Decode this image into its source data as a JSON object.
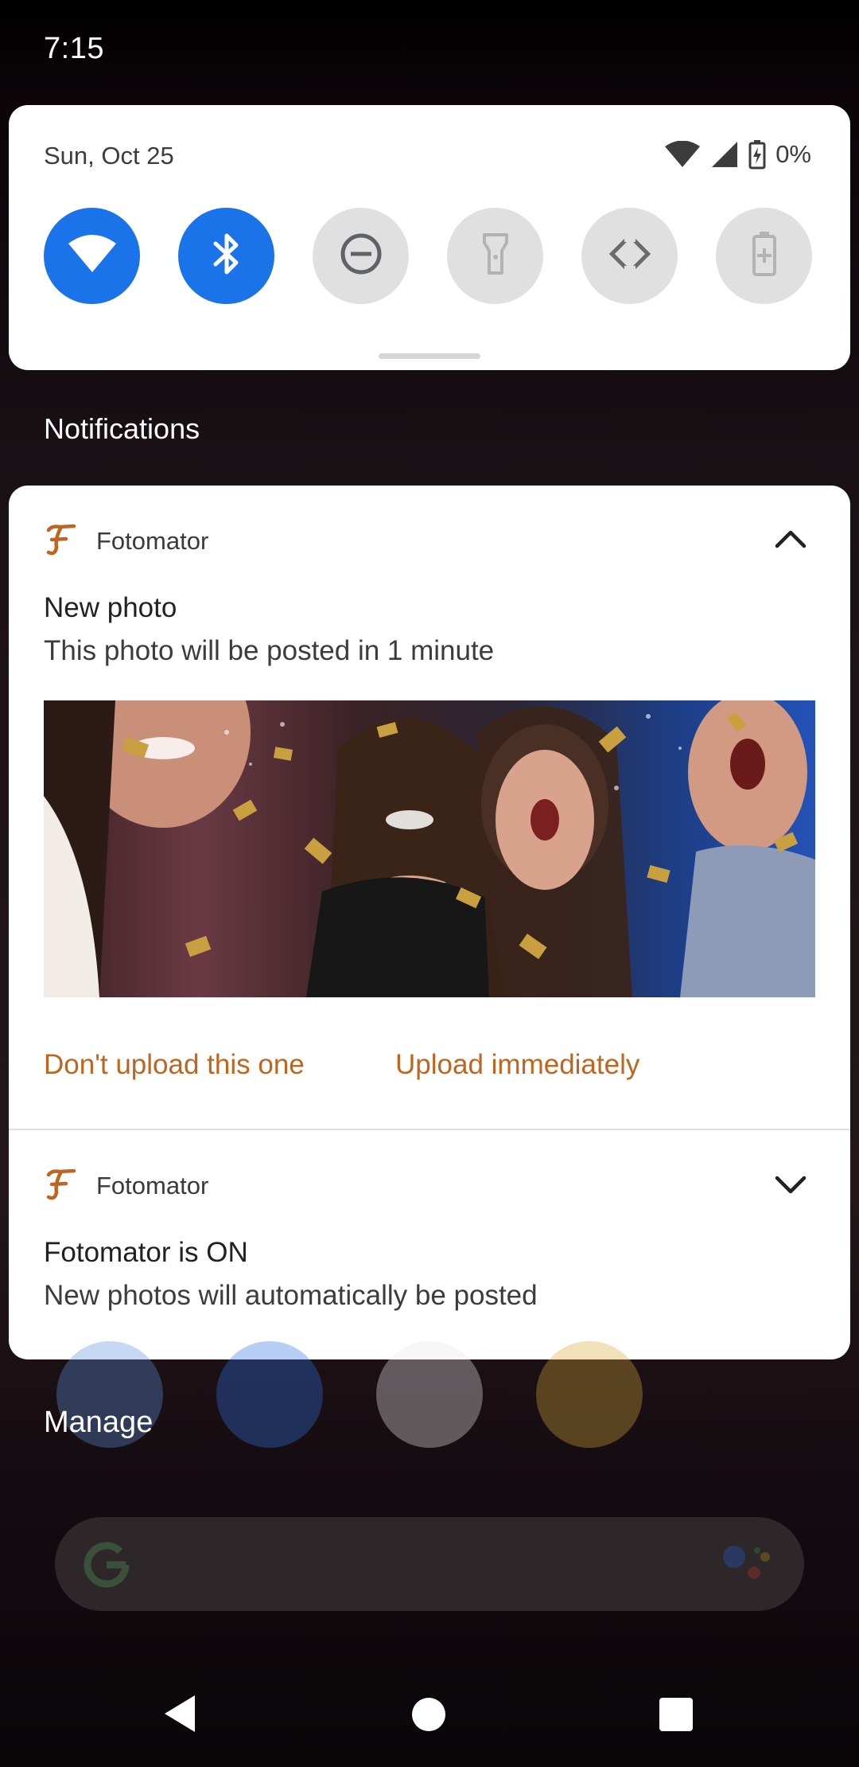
{
  "status_bar": {
    "time": "7:15",
    "battery_percent": "0%"
  },
  "quick_settings": {
    "date": "Sun, Oct 25",
    "tiles": [
      {
        "name": "wifi",
        "state": "on"
      },
      {
        "name": "bluetooth",
        "state": "on"
      },
      {
        "name": "do-not-disturb",
        "state": "off"
      },
      {
        "name": "flashlight",
        "state": "off"
      },
      {
        "name": "auto-rotate",
        "state": "off"
      },
      {
        "name": "battery-saver",
        "state": "off"
      }
    ]
  },
  "notifications_header": "Notifications",
  "notifications": [
    {
      "app": "Fotomator",
      "title": "New photo",
      "text": "This photo will be posted in 1 minute",
      "expanded": true,
      "actions": [
        "Don't upload this one",
        "Upload immediately"
      ]
    },
    {
      "app": "Fotomator",
      "title": "Fotomator is ON",
      "text": "New photos will automatically be posted",
      "expanded": false
    }
  ],
  "manage_label": "Manage",
  "colors": {
    "accent_blue": "#1a73e8",
    "action_orange": "#c0651f",
    "app_icon_orange": "#c0651f"
  }
}
